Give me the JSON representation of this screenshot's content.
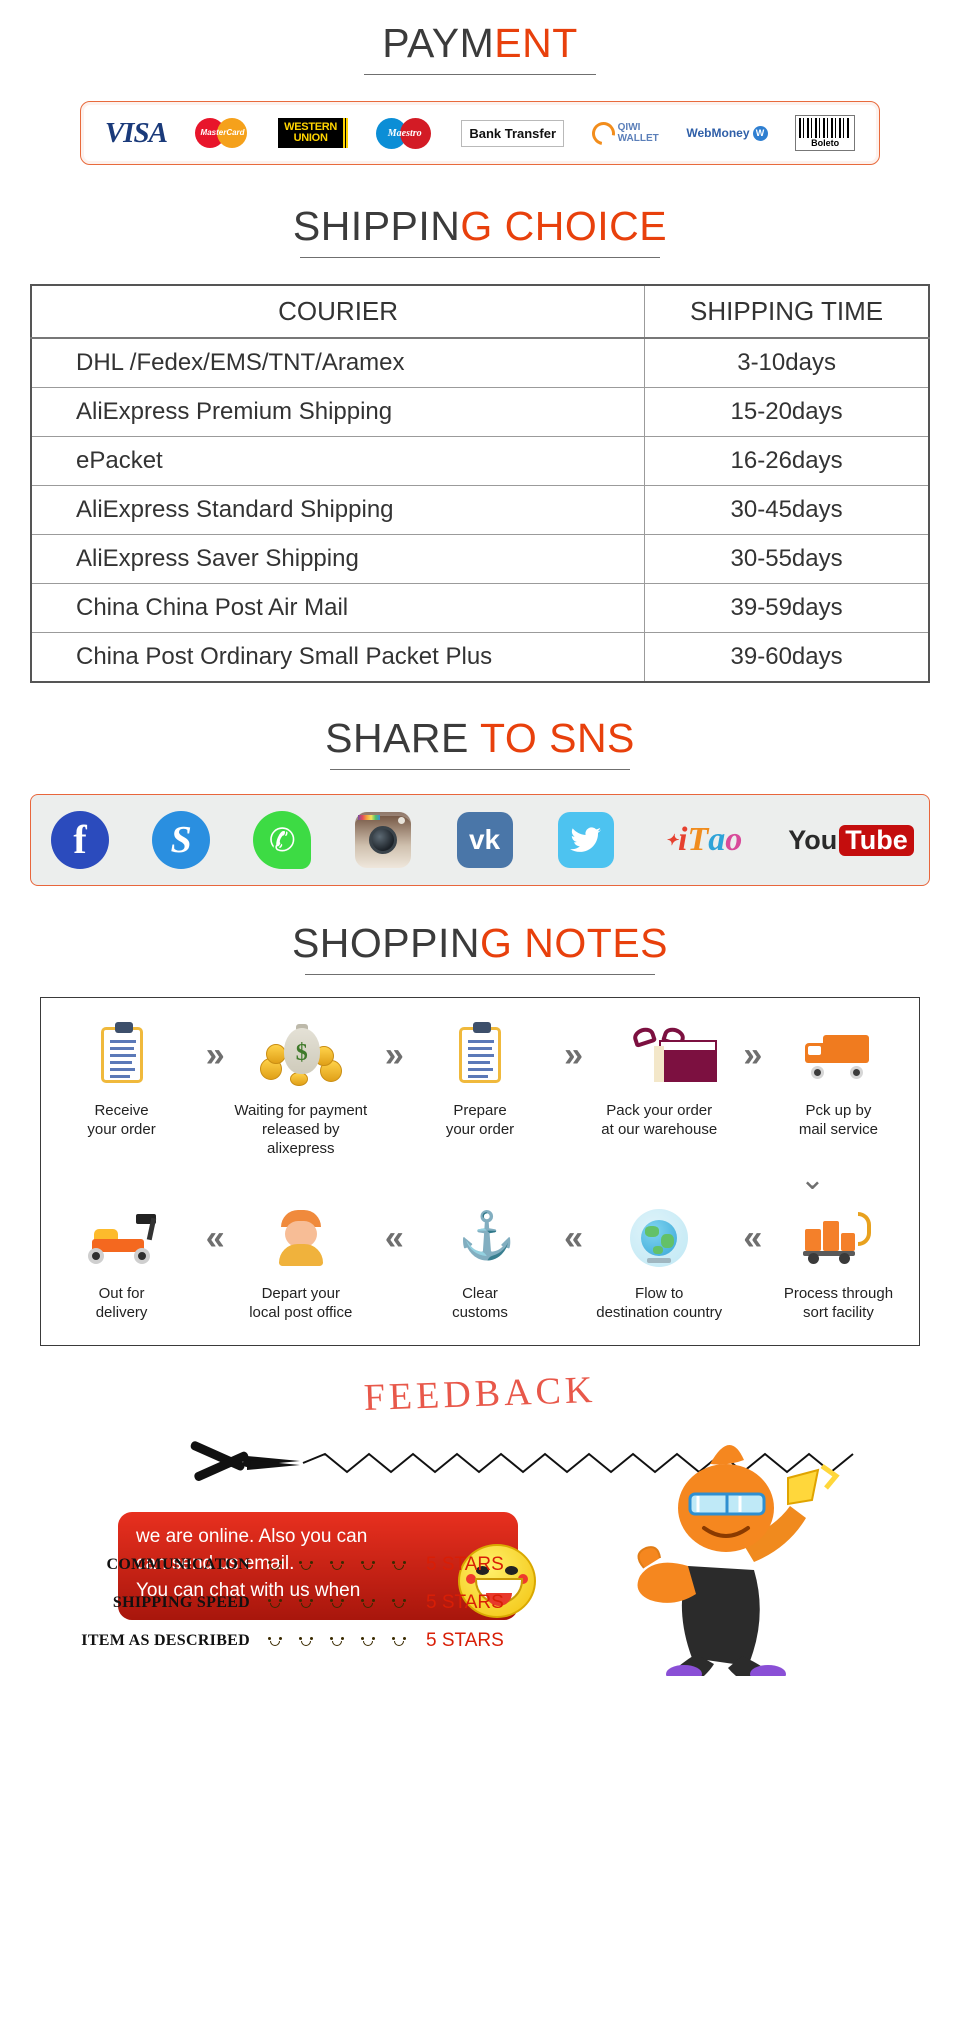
{
  "payment": {
    "heading_dark": "PAYM",
    "heading_accent": "ENT",
    "methods": [
      {
        "name": "visa",
        "label": "VISA"
      },
      {
        "name": "mastercard",
        "label": "MasterCard"
      },
      {
        "name": "western-union",
        "line1": "WESTERN",
        "line2": "UNION"
      },
      {
        "name": "maestro",
        "label": "Maestro"
      },
      {
        "name": "bank-transfer",
        "label": "Bank Transfer"
      },
      {
        "name": "qiwi-wallet",
        "line1": "QIWI",
        "line2": "WALLET"
      },
      {
        "name": "webmoney",
        "label": "WebMoney"
      },
      {
        "name": "boleto",
        "label": "Boleto"
      }
    ]
  },
  "shipping": {
    "heading_dark": "SHIPPIN",
    "heading_accent": "G CHOICE",
    "columns": [
      "COURIER",
      "SHIPPING TIME"
    ],
    "rows": [
      {
        "courier": "DHL /Fedex/EMS/TNT/Aramex",
        "time": "3-10days"
      },
      {
        "courier": "AliExpress Premium Shipping",
        "time": "15-20days"
      },
      {
        "courier": "ePacket",
        "time": "16-26days"
      },
      {
        "courier": "AliExpress Standard Shipping",
        "time": "30-45days"
      },
      {
        "courier": "AliExpress Saver Shipping",
        "time": "30-55days"
      },
      {
        "courier": "China China Post Air Mail",
        "time": "39-59days"
      },
      {
        "courier": "China Post Ordinary Small Packet Plus",
        "time": "39-60days"
      }
    ]
  },
  "sns": {
    "heading_dark": "SHARE ",
    "heading_accent": "TO SNS",
    "icons": [
      {
        "name": "facebook-icon",
        "label": "f"
      },
      {
        "name": "skype-icon",
        "label": "S"
      },
      {
        "name": "whatsapp-icon",
        "label": "✆"
      },
      {
        "name": "instagram-icon",
        "label": ""
      },
      {
        "name": "vk-icon",
        "label": "vk"
      },
      {
        "name": "twitter-icon",
        "label": "ᵕ"
      },
      {
        "name": "itao-icon",
        "label": "iTao"
      },
      {
        "name": "youtube-icon",
        "label_you": "You",
        "label_tube": "Tube"
      }
    ]
  },
  "notes": {
    "heading_dark": "SHOPPIN",
    "heading_accent": "G NOTES",
    "row1": [
      {
        "icon": "clipboard-icon",
        "label": "Receive\nyour order"
      },
      {
        "icon": "money-bag-icon",
        "label": "Waiting for payment\nreleased by alixepress"
      },
      {
        "icon": "clipboard-icon",
        "label": "Prepare\nyour order"
      },
      {
        "icon": "gift-box-icon",
        "label": "Pack your order\nat our warehouse"
      },
      {
        "icon": "delivery-truck-icon",
        "label": "Pck up by\nmail service"
      }
    ],
    "row2": [
      {
        "icon": "scooter-icon",
        "label": "Out for\ndelivery"
      },
      {
        "icon": "postman-icon",
        "label": "Depart your\nlocal post office"
      },
      {
        "icon": "anchor-icon",
        "label": "Clear\ncustoms"
      },
      {
        "icon": "globe-icon",
        "label": "Flow to\ndestination country"
      },
      {
        "icon": "parcel-cart-icon",
        "label": "Process through\nsort facility"
      }
    ],
    "arrow_forward": "»",
    "arrow_back": "«",
    "arrow_down": "⌄"
  },
  "feedback": {
    "title": "FEEDBACK",
    "bubble_lines": [
      "we are online. Also you can",
      "can send us email.",
      "You can chat with us when"
    ],
    "ratings": [
      {
        "label": "COMMUNICATON",
        "stars": 5,
        "value": "5 STARS"
      },
      {
        "label": "SHIPPING SPEED",
        "stars": 5,
        "value": "5 STARS"
      },
      {
        "label": "ITEM AS DESCRIBED",
        "stars": 5,
        "value": "5 STARS"
      }
    ]
  },
  "colors": {
    "accent": "#e8400c",
    "dark": "#3b3b3b",
    "rating_value": "#d81e06",
    "border_orange": "#e8663c"
  }
}
